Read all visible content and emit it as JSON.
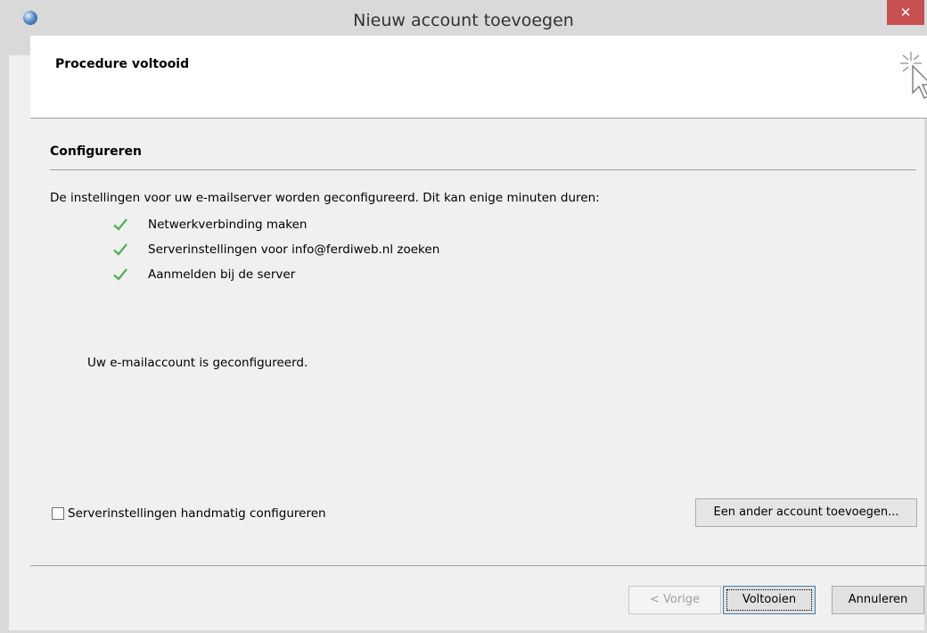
{
  "window": {
    "title": "Nieuw account toevoegen",
    "close_label": "✕"
  },
  "header": {
    "title": "Procedure voltooid"
  },
  "section": {
    "title": "Configureren"
  },
  "intro": "De instellingen voor uw e-mailserver worden geconfigureerd. Dit kan enige minuten duren:",
  "steps": [
    {
      "label": "Netwerkverbinding maken",
      "status": "done"
    },
    {
      "label": "Serverinstellingen voor info@ferdiweb.nl zoeken",
      "status": "done"
    },
    {
      "label": "Aanmelden bij de server",
      "status": "done"
    }
  ],
  "done_message": "Uw e-mailaccount is geconfigureerd.",
  "manual_config": {
    "label": "Serverinstellingen handmatig configureren",
    "checked": false
  },
  "buttons": {
    "add_account": "Een ander account toevoegen...",
    "previous": "< Vorige",
    "finish": "Voltooien",
    "cancel": "Annuleren"
  },
  "colors": {
    "check": "#4cb04c",
    "close_button": "#c75050",
    "focus_border": "#3c7fb1"
  }
}
